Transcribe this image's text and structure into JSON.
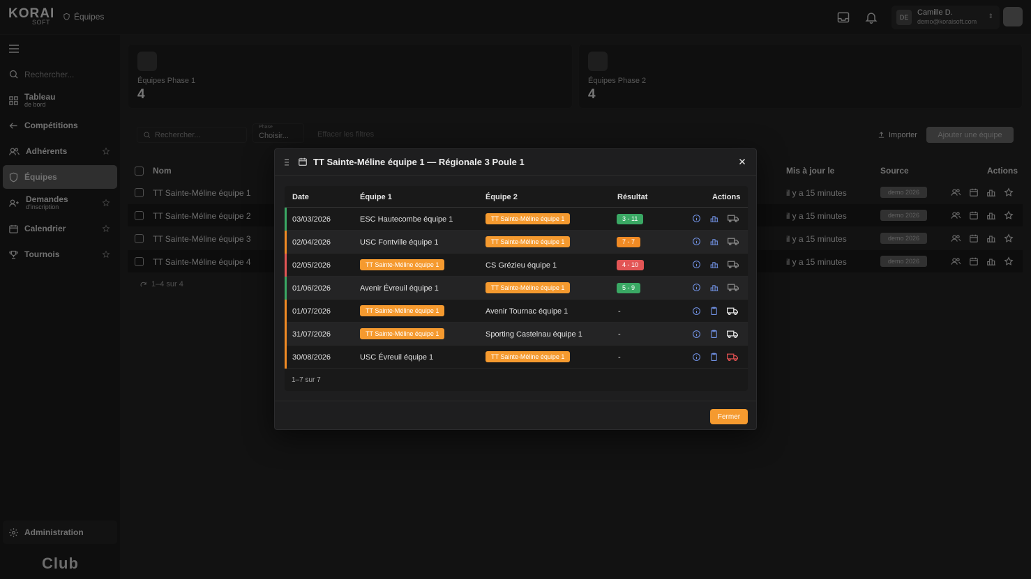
{
  "brand": {
    "top": "KORAI",
    "bottom": "SOFT"
  },
  "header": {
    "breadcrumb": "Équipes",
    "user": {
      "initials": "DE",
      "name": "Camille D.",
      "email": "demo@koraisoft.com"
    }
  },
  "sidebar": {
    "search_placeholder": "Rechercher...",
    "items": [
      {
        "label": "Tableau",
        "sub": "de bord",
        "icon": "grid-icon"
      },
      {
        "label": "Compétitions",
        "sub": "",
        "icon": "arrow-left-icon"
      },
      {
        "label": "Adhérents",
        "sub": "",
        "icon": "users-icon"
      },
      {
        "label": "Équipes",
        "sub": "",
        "icon": "shield-icon",
        "active": true
      },
      {
        "label": "Demandes",
        "sub": "d'inscription",
        "icon": "user-plus-icon"
      },
      {
        "label": "Calendrier",
        "sub": "",
        "icon": "calendar-icon"
      },
      {
        "label": "Tournois",
        "sub": "",
        "icon": "trophy-icon"
      }
    ],
    "admin": "Administration",
    "footer": "Club"
  },
  "stats": [
    {
      "label": "Équipes Phase 1",
      "value": "4"
    },
    {
      "label": "Équipes Phase 2",
      "value": "4"
    }
  ],
  "filters": {
    "search_placeholder": "Rechercher...",
    "phase_label": "Phase",
    "phase_value": "Choisir...",
    "clear": "Effacer les filtres",
    "import": "Importer",
    "add": "Ajouter une équipe"
  },
  "table": {
    "headers": {
      "name": "Nom",
      "updated": "Mis à jour le",
      "source": "Source",
      "actions": "Actions"
    },
    "rows": [
      {
        "name": "TT Sainte-Méline équipe 1",
        "updated": "il y a 15 minutes",
        "source": "demo 2026"
      },
      {
        "name": "TT Sainte-Méline équipe 2",
        "updated": "il y a 15 minutes",
        "source": "demo 2026"
      },
      {
        "name": "TT Sainte-Méline équipe 3",
        "updated": "il y a 15 minutes",
        "source": "demo 2026"
      },
      {
        "name": "TT Sainte-Méline équipe 4",
        "updated": "il y a 15 minutes",
        "source": "demo 2026"
      }
    ],
    "pager": "1–4 sur 4"
  },
  "modal": {
    "title": "TT Sainte-Méline équipe 1 — Régionale 3 Poule 1",
    "headers": {
      "date": "Date",
      "team1": "Équipe 1",
      "team2": "Équipe 2",
      "result": "Résultat",
      "actions": "Actions"
    },
    "rows": [
      {
        "date": "03/03/2026",
        "team1": "ESC Hautecombe équipe 1",
        "team2": "TT Sainte-Méline équipe 1",
        "highlight": "team2",
        "result": "3 - 11",
        "result_color": "#3aa864",
        "bar_color": "#3aa864",
        "played": true,
        "truck_color": "#8a8a8a"
      },
      {
        "date": "02/04/2026",
        "team1": "USC Fontville équipe 1",
        "team2": "TT Sainte-Méline équipe 1",
        "highlight": "team2",
        "result": "7 - 7",
        "result_color": "#f08a24",
        "bar_color": "#f08a24",
        "played": true,
        "truck_color": "#8a8a8a"
      },
      {
        "date": "02/05/2026",
        "team1": "TT Sainte-Méline équipe 1",
        "team2": "CS Grézieu équipe 1",
        "highlight": "team1",
        "result": "4 - 10",
        "result_color": "#e25555",
        "bar_color": "#e25555",
        "played": true,
        "truck_color": "#8a8a8a"
      },
      {
        "date": "01/06/2026",
        "team1": "Avenir Évreuil équipe 1",
        "team2": "TT Sainte-Méline équipe 1",
        "highlight": "team2",
        "result": "5 - 9",
        "result_color": "#3aa864",
        "bar_color": "#3aa864",
        "played": true,
        "truck_color": "#8a8a8a"
      },
      {
        "date": "01/07/2026",
        "team1": "TT Sainte-Méline équipe 1",
        "team2": "Avenir Tournac équipe 1",
        "highlight": "team1",
        "result": "-",
        "result_color": "",
        "bar_color": "#f08a24",
        "played": false,
        "truck_color": "#e8e8e8"
      },
      {
        "date": "31/07/2026",
        "team1": "TT Sainte-Méline équipe 1",
        "team2": "Sporting Castelnau équipe 1",
        "highlight": "team1",
        "result": "-",
        "result_color": "",
        "bar_color": "#f08a24",
        "played": false,
        "truck_color": "#e8e8e8"
      },
      {
        "date": "30/08/2026",
        "team1": "USC Évreuil équipe 1",
        "team2": "TT Sainte-Méline équipe 1",
        "highlight": "team2",
        "result": "-",
        "result_color": "",
        "bar_color": "#f08a24",
        "played": false,
        "truck_color": "#e05050"
      }
    ],
    "footer": "1–7 sur 7",
    "close_label": "Fermer"
  },
  "colors": {
    "accent": "#f59a2f",
    "win": "#3aa864",
    "loss": "#e25555",
    "draw": "#f08a24",
    "link": "#6f8fe0"
  }
}
